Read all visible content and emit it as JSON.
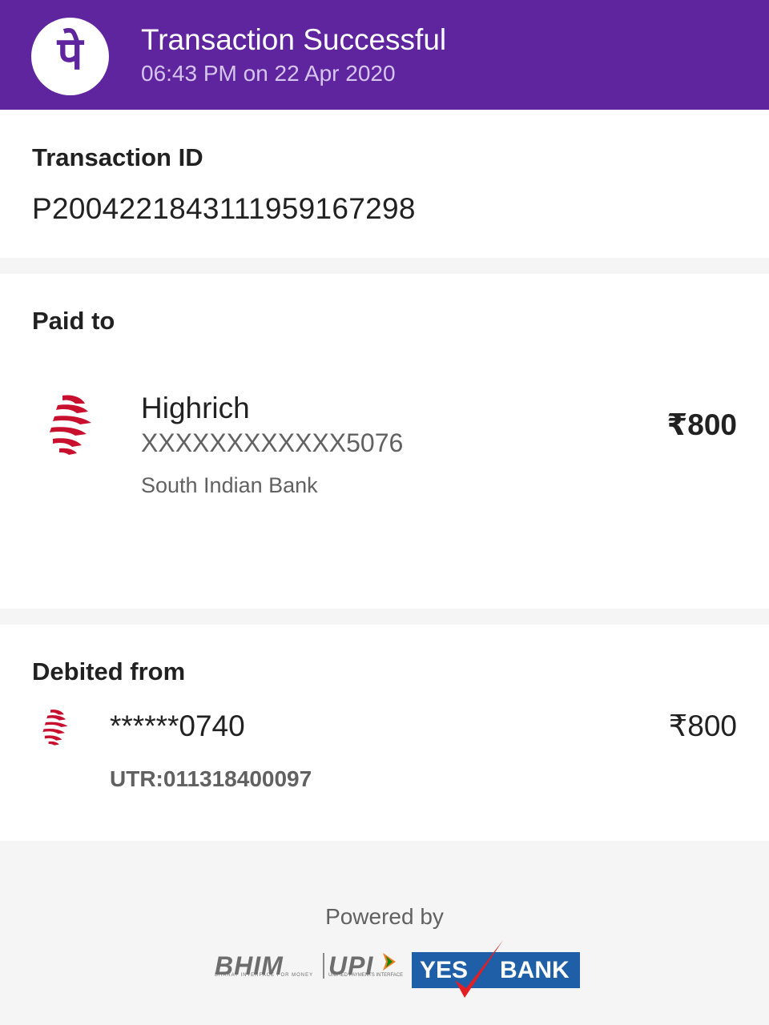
{
  "header": {
    "logo_glyph": "पे",
    "title": "Transaction Successful",
    "subtitle": "06:43 PM on 22 Apr 2020",
    "background_color": "#5f259f"
  },
  "transaction": {
    "label": "Transaction ID",
    "id": "P2004221843111959167298"
  },
  "paid_to": {
    "label": "Paid to",
    "bank_logo_icon": "south-indian-bank-logo-icon",
    "name": "Highrich",
    "account": "XXXXXXXXXXXX5076",
    "bank": "South Indian Bank",
    "amount": "₹800"
  },
  "debited_from": {
    "label": "Debited from",
    "bank_logo_icon": "south-indian-bank-logo-icon",
    "account": "******0740",
    "amount": "₹800",
    "utr": "UTR:011318400097"
  },
  "footer": {
    "powered_by": "Powered by",
    "bhim": "BHIM",
    "bhim_tagline": "BHARAT INTERFACE FOR MONEY",
    "upi": "UPI",
    "upi_tagline": "UNIFIED PAYMENTS INTERFACE",
    "yes": "YES",
    "bank": "BANK",
    "yes_bank_color": "#1e5fa8"
  }
}
